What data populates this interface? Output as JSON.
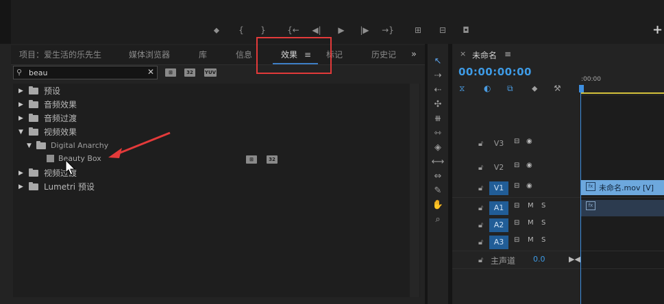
{
  "program_monitor": {
    "transport_icons": [
      "marker-icon",
      "mark-in-icon",
      "mark-out-icon",
      "go-to-in-icon",
      "step-back-icon",
      "play-icon",
      "step-forward-icon",
      "go-to-out-icon",
      "insert-icon",
      "overwrite-icon",
      "export-frame-icon"
    ],
    "transport_glyphs": [
      "⬥",
      "{",
      "}",
      "{←",
      "◀|",
      "▶",
      "|▶",
      "→}",
      "⊞",
      "⊟",
      "◘"
    ],
    "add_button": "+"
  },
  "left_panel": {
    "tabs": [
      {
        "label": "项目：爱生活的乐先生"
      },
      {
        "label": "媒体浏览器"
      },
      {
        "label": "库"
      },
      {
        "label": "信息"
      },
      {
        "label": "效果",
        "active": true
      },
      {
        "label": "标记"
      },
      {
        "label": "历史记"
      }
    ],
    "tab_menu": "≡",
    "overflow": "»"
  },
  "effects": {
    "search_value": "beau",
    "badges": [
      "⊞",
      "32",
      "YUV"
    ],
    "tree": [
      {
        "label": "预设",
        "expanded": false
      },
      {
        "label": "音频效果",
        "expanded": false
      },
      {
        "label": "音频过渡",
        "expanded": false
      },
      {
        "label": "视频效果",
        "expanded": true
      },
      {
        "label": "Digital Anarchy",
        "expanded": true
      },
      {
        "label": "Beauty Box"
      },
      {
        "label": "视频过渡",
        "expanded": false
      },
      {
        "label": "Lumetri 预设",
        "expanded": false
      }
    ],
    "item_badges": [
      "⊞",
      "32"
    ]
  },
  "timeline": {
    "sequence_name": "未命名",
    "menu": "≡",
    "timecode": "00:00:00:00",
    "ruler_start": ":00:00",
    "tracks": [
      {
        "name": "V3",
        "active": false
      },
      {
        "name": "V2",
        "active": false
      },
      {
        "name": "V1",
        "active": true
      },
      {
        "name": "A1",
        "active": true
      },
      {
        "name": "A2",
        "active": true
      },
      {
        "name": "A3",
        "active": true
      }
    ],
    "audio_track_labels": {
      "mute": "M",
      "solo": "S"
    },
    "clip_label": "未命名.mov [V]",
    "fx_badge": "fx",
    "master_label": "主声道",
    "master_value": "0.0",
    "master_end": "▶◀"
  },
  "colors": {
    "accent": "#3e9be6",
    "highlight_box": "#e43a3a",
    "clip_video": "#6da8dd"
  }
}
